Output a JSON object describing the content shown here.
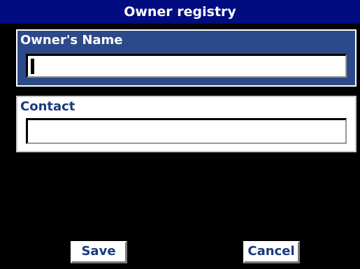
{
  "window": {
    "title": "Owner registry"
  },
  "form": {
    "owner_name": {
      "label": "Owner's Name",
      "value": ""
    },
    "contact": {
      "label": "Contact",
      "value": ""
    }
  },
  "buttons": {
    "save_label": "Save",
    "cancel_label": "Cancel"
  },
  "colors": {
    "title_bar": "#000c80",
    "active_group": "#2c4a8a",
    "label_text": "#1a3a80",
    "background": "#000000"
  }
}
